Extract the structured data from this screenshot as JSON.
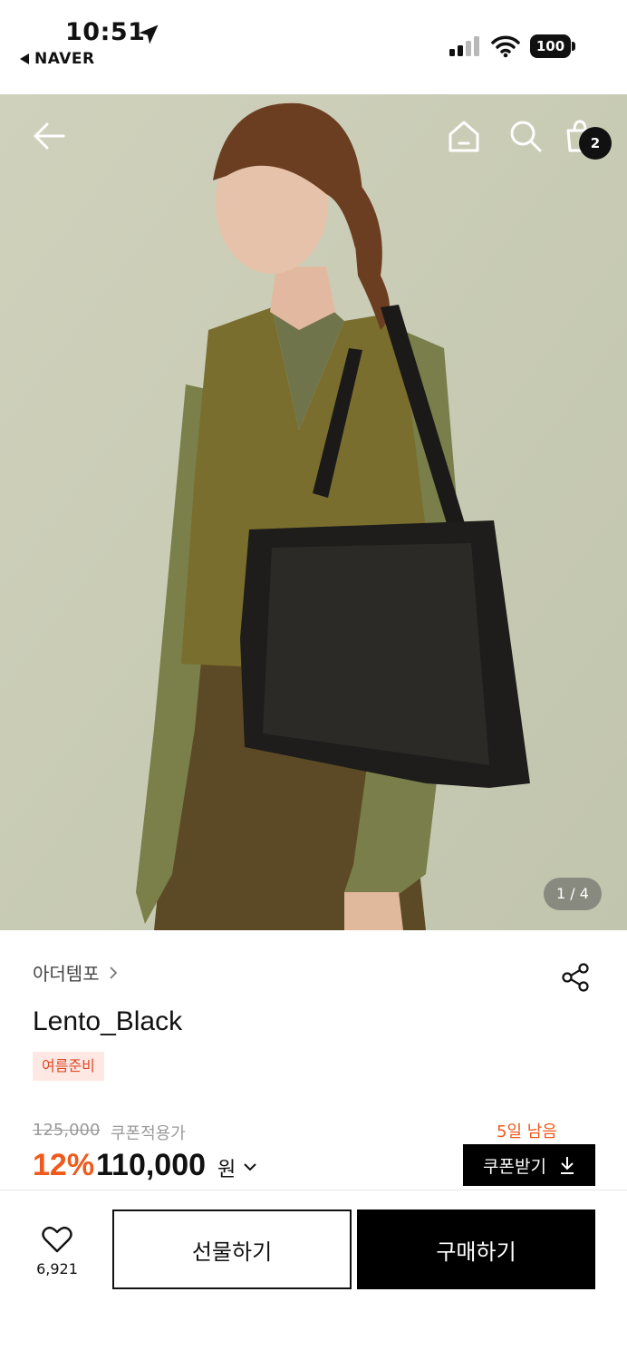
{
  "status_bar": {
    "time": "10:51",
    "back_app": "NAVER",
    "battery": "100",
    "icons": [
      "location-arrow-icon",
      "signal-icon",
      "wifi-icon",
      "battery-icon"
    ]
  },
  "header": {
    "icons": [
      "back-arrow-icon",
      "home-icon",
      "search-icon",
      "shopping-bag-icon"
    ],
    "cart_count": "2"
  },
  "gallery": {
    "pager": "1 / 4"
  },
  "product": {
    "brand": "아더템포",
    "name": "Lento_Black",
    "tag": "여름준비",
    "original_price": "125,000",
    "coupon_label": "쿠폰적용가",
    "discount": "12%",
    "price": "110,000",
    "currency": "원",
    "days_left": "5일 남음",
    "coupon_button": "쿠폰받기"
  },
  "bottom_bar": {
    "like_count": "6,921",
    "gift_button": "선물하기",
    "buy_button": "구매하기"
  },
  "colors": {
    "accent": "#ee5a1c",
    "tag_bg": "#fde8e3",
    "primary": "#000000"
  }
}
